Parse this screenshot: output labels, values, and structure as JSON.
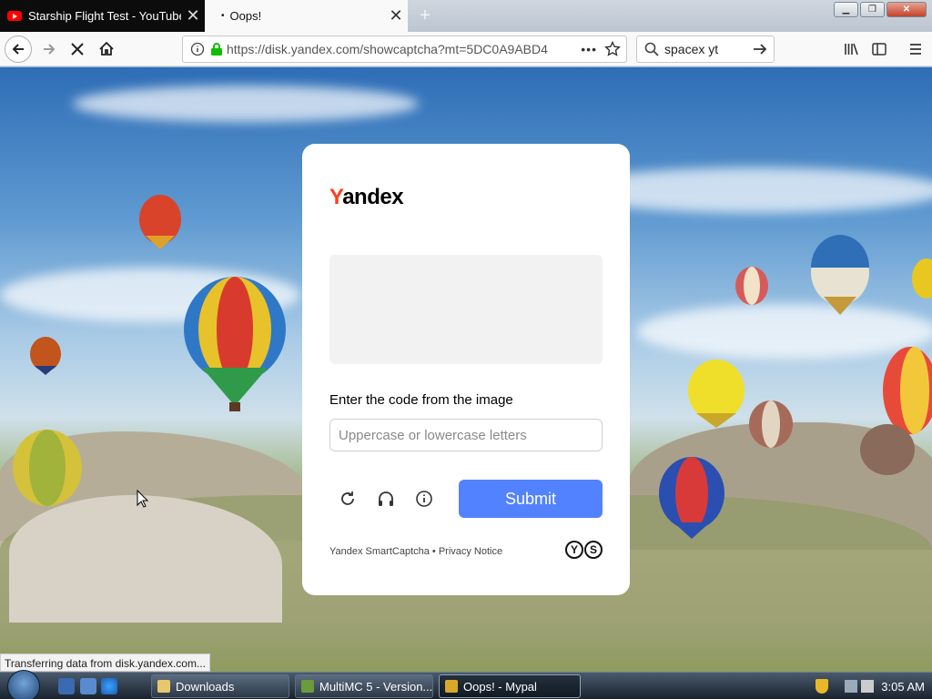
{
  "tabs": [
    {
      "label": "Starship Flight Test - YouTube",
      "icon": "youtube-icon",
      "active": false
    },
    {
      "label": "Oops!",
      "icon": "dot-icon",
      "active": true
    }
  ],
  "newtab_label": "+",
  "close_glyph": "✕",
  "nav": {
    "url": "https://disk.yandex.com/showcaptcha?mt=5DC0A9ABD4",
    "search_value": "spacex yt",
    "page_actions": "•••"
  },
  "captcha": {
    "brand_first": "Y",
    "brand_rest": "andex",
    "prompt": "Enter the code from the image",
    "input_value": "",
    "input_placeholder": "Uppercase or lowercase letters",
    "submit_label": "Submit",
    "footer_text": "Yandex SmartCaptcha • Privacy Notice",
    "footer_logo_1": "Y",
    "footer_logo_2": "S"
  },
  "status_text": "Transferring data from disk.yandex.com...",
  "taskbar": {
    "tasks": [
      {
        "label": "Downloads",
        "active": false
      },
      {
        "label": "MultiMC 5 - Version...",
        "active": false
      },
      {
        "label": "Oops! - Mypal",
        "active": true
      }
    ],
    "clock": "3:05 AM"
  },
  "colors": {
    "yandex_red": "#fc3f1d",
    "submit_blue": "#5282ff",
    "url_lock_green": "#12bc00"
  }
}
